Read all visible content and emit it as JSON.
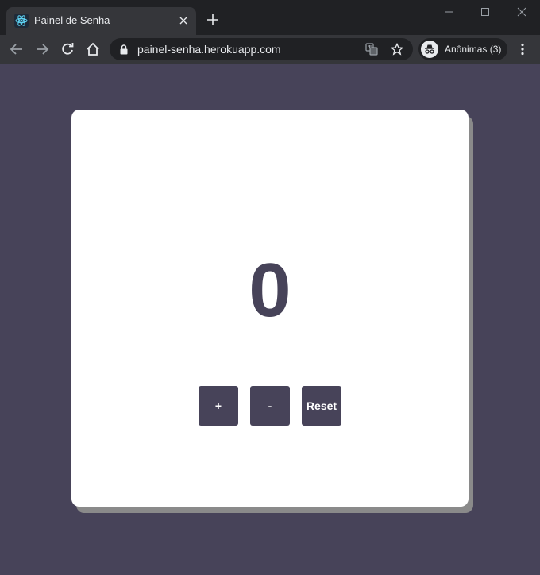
{
  "browser": {
    "tab": {
      "title": "Painel de Senha",
      "favicon": "react-icon"
    },
    "address_bar": {
      "url": "painel-senha.herokuapp.com"
    },
    "profile": {
      "label": "Anônimas (3)",
      "icon": "incognito-icon"
    }
  },
  "page": {
    "counter": {
      "value": "0"
    },
    "buttons": {
      "increment_label": "+",
      "decrement_label": "-",
      "reset_label": "Reset"
    }
  },
  "colors": {
    "background": "#474359",
    "card": "#ffffff",
    "button": "#474359",
    "counter_text": "#474359"
  }
}
